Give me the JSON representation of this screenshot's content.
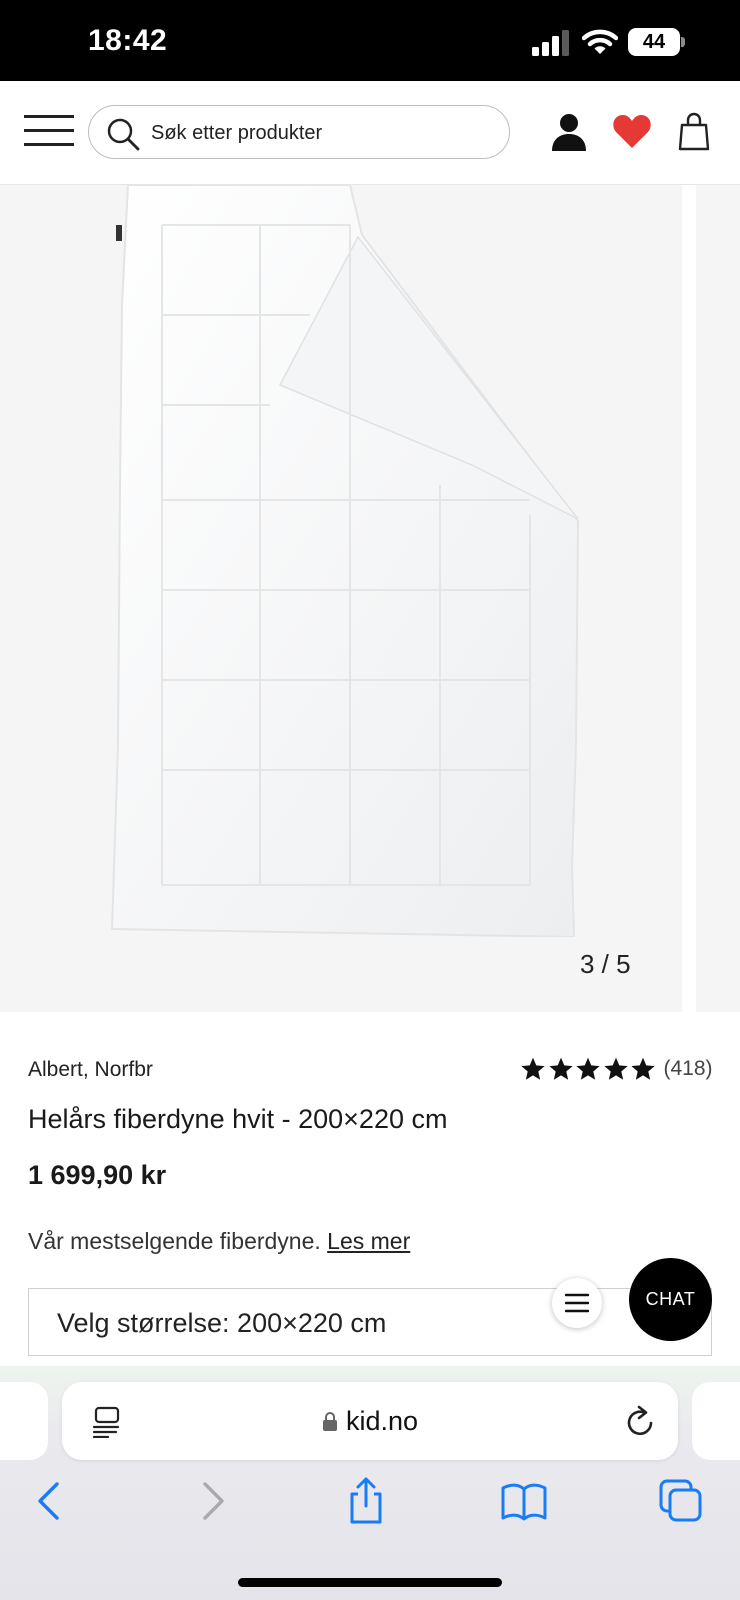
{
  "status_bar": {
    "time": "18:42",
    "battery": "44",
    "icons": [
      "signal-icon",
      "wifi-icon",
      "battery-icon"
    ]
  },
  "header": {
    "menu_icon": "hamburger-menu-icon",
    "search": {
      "placeholder": "Søk etter produkter",
      "icon": "search-icon"
    },
    "icons": [
      "user-icon",
      "heart-icon",
      "shopping-bag-icon"
    ],
    "heart_color": "#e53935"
  },
  "gallery": {
    "counter": "3 / 5",
    "current": 3,
    "total": 5
  },
  "product": {
    "brand": "Albert, Norfbr",
    "rating": {
      "stars": 5,
      "max": 5,
      "count_label": "(418)"
    },
    "title": "Helårs fiberdyne hvit - 200×220 cm",
    "price": "1 699,90 kr",
    "description": "Vår mestselgende fiberdyne.",
    "read_more": "Les mer",
    "size_select": "Velg størrelse: 200×220 cm"
  },
  "floating": {
    "list_icon": "list-icon",
    "chat_label": "CHAT"
  },
  "browser": {
    "url": "kid.no",
    "icons": [
      "reader-icon",
      "lock-icon",
      "reload-icon"
    ],
    "nav_icons": [
      "back-icon",
      "forward-icon",
      "share-icon",
      "bookmarks-icon",
      "tabs-icon"
    ],
    "accent": "#1a7cf5"
  }
}
